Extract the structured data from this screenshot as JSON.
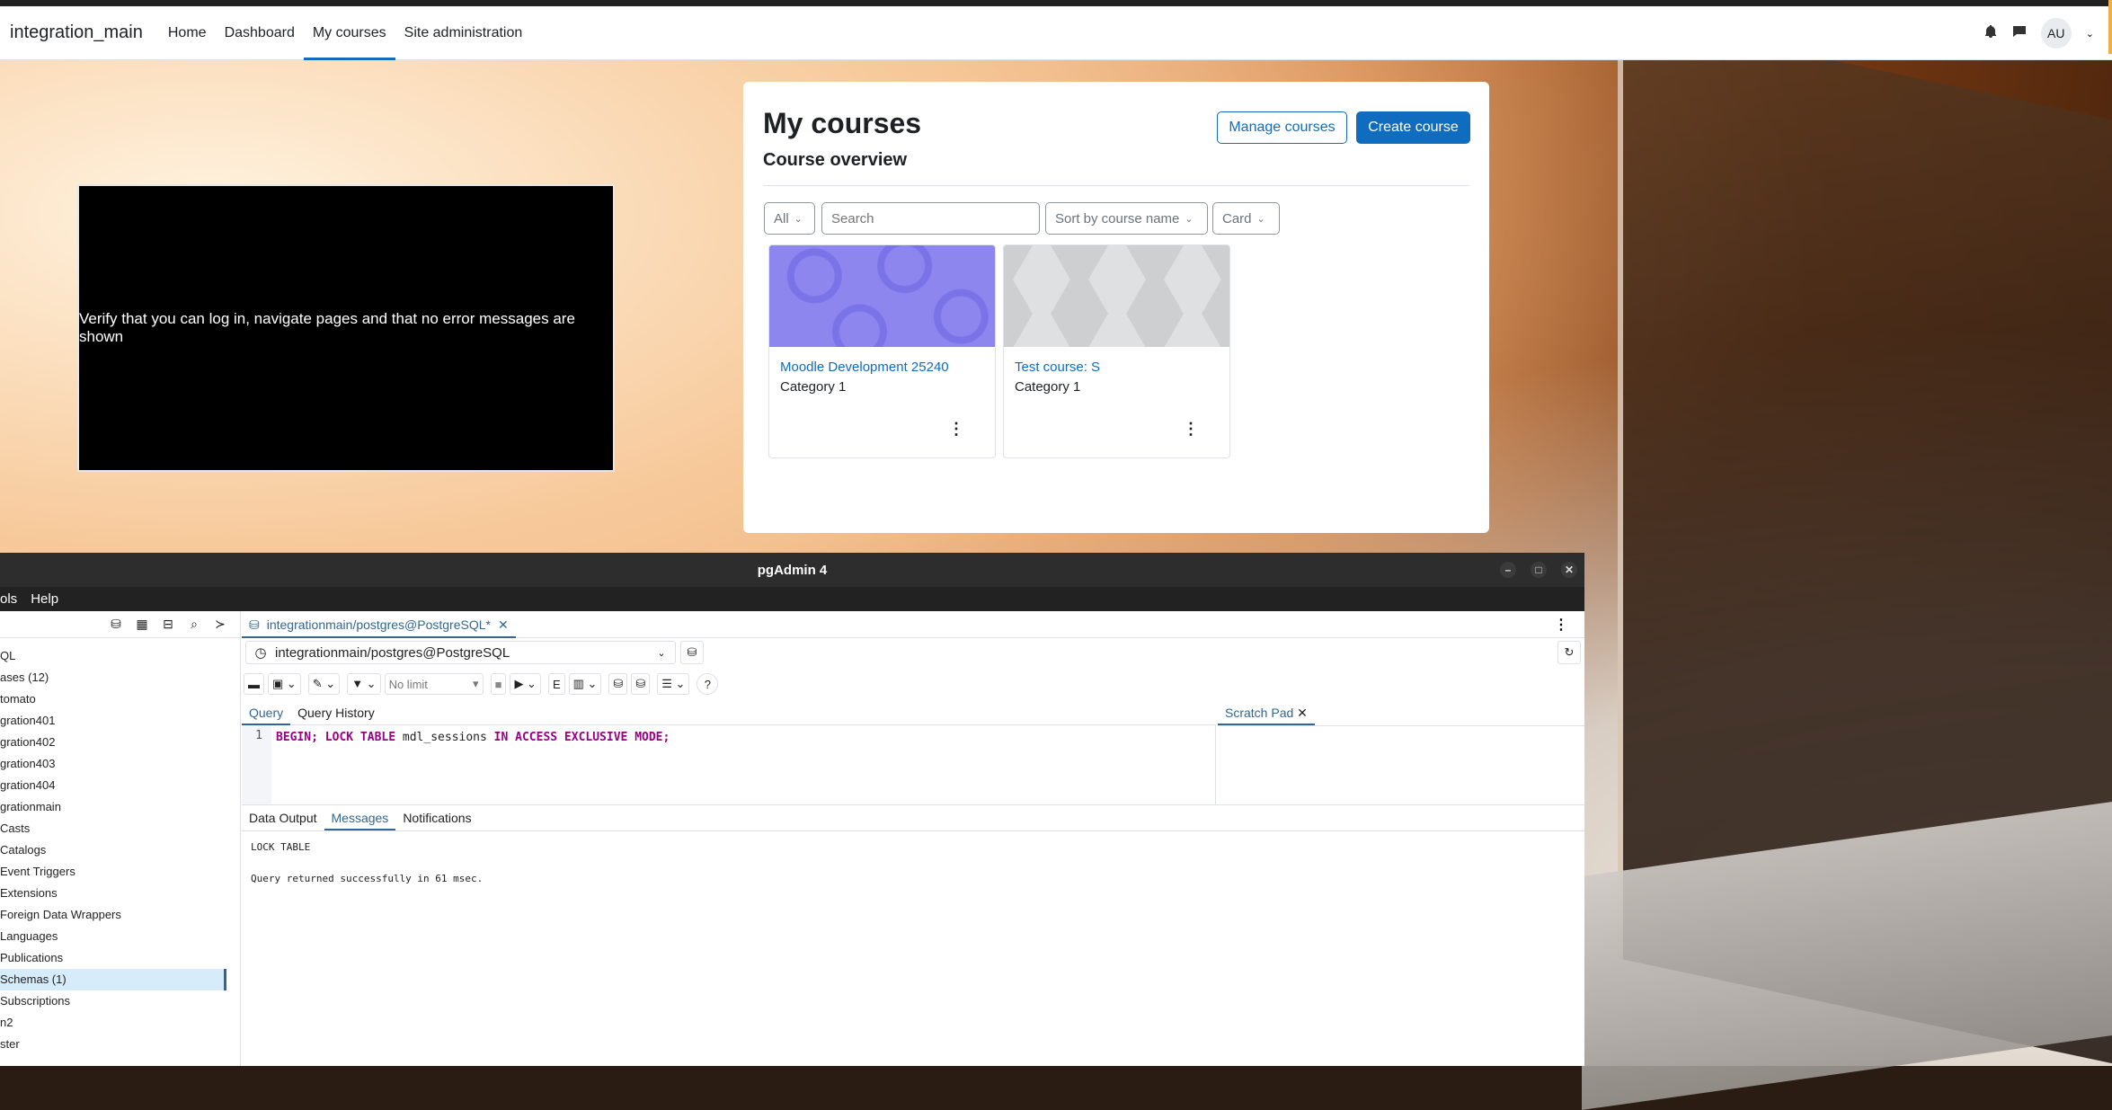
{
  "navbar": {
    "brand": "integration_main",
    "links": [
      "Home",
      "Dashboard",
      "My courses",
      "Site administration"
    ],
    "avatar": "AU"
  },
  "video_overlay": {
    "text": "Verify that you can log in, navigate pages and that no error messages are shown"
  },
  "courses_page": {
    "title": "My courses",
    "subtitle": "Course overview",
    "manage_button": "Manage courses",
    "create_button": "Create course",
    "filter_all": "All",
    "search_placeholder": "Search",
    "sort": "Sort by course name",
    "view": "Card",
    "courses": [
      {
        "title": "Moodle Development 25240",
        "category": "Category 1"
      },
      {
        "title": "Test course: S",
        "category": "Category 1"
      }
    ]
  },
  "pgadmin": {
    "window_title": "pgAdmin 4",
    "menu": [
      "ols",
      "Help"
    ],
    "tree": [
      "QL",
      "ases (12)",
      "tomato",
      "gration401",
      "gration402",
      "gration403",
      "gration404",
      "grationmain",
      "Casts",
      "Catalogs",
      "Event Triggers",
      "Extensions",
      "Foreign Data Wrappers",
      "Languages",
      "Publications",
      "Schemas (1)",
      "Subscriptions",
      "n2",
      "ster"
    ],
    "query_tab": "integrationmain/postgres@PostgreSQL*",
    "connection": "integrationmain/postgres@PostgreSQL",
    "limit": "No limit",
    "editor_tabs": [
      "Query",
      "Query History"
    ],
    "scratch_pad": "Scratch Pad",
    "line_number": "1",
    "sql": {
      "begin": "BEGIN;",
      "lock": "LOCK TABLE",
      "table": "mdl_sessions",
      "mode": "IN ACCESS EXCLUSIVE MODE;"
    },
    "output_tabs": [
      "Data Output",
      "Messages",
      "Notifications"
    ],
    "messages": [
      "LOCK TABLE",
      "Query returned successfully in 61 msec."
    ]
  }
}
